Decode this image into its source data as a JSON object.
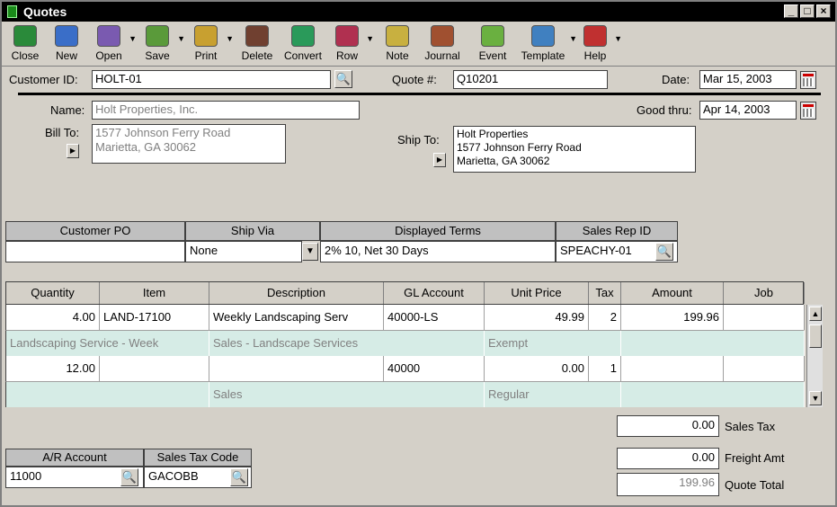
{
  "window": {
    "title": "Quotes"
  },
  "toolbar": [
    {
      "label": "Close",
      "icon": "close-icon"
    },
    {
      "label": "New",
      "icon": "new-icon"
    },
    {
      "label": "Open",
      "icon": "open-icon"
    },
    {
      "label": "Save",
      "icon": "save-icon"
    },
    {
      "label": "Print",
      "icon": "print-icon"
    },
    {
      "label": "Delete",
      "icon": "delete-icon"
    },
    {
      "label": "Convert",
      "icon": "convert-icon"
    },
    {
      "label": "Row",
      "icon": "row-icon"
    },
    {
      "label": "Note",
      "icon": "note-icon"
    },
    {
      "label": "Journal",
      "icon": "journal-icon"
    },
    {
      "label": "Event",
      "icon": "event-icon"
    },
    {
      "label": "Template",
      "icon": "template-icon"
    },
    {
      "label": "Help",
      "icon": "help-icon"
    }
  ],
  "header": {
    "customer_id_label": "Customer ID:",
    "customer_id": "HOLT-01",
    "quote_label": "Quote #:",
    "quote_no": "Q10201",
    "date_label": "Date:",
    "date": "Mar 15, 2003",
    "name_label": "Name:",
    "name": "Holt Properties, Inc.",
    "good_thru_label": "Good thru:",
    "good_thru": "Apr 14, 2003",
    "bill_to_label": "Bill To:",
    "bill_to_1": "1577 Johnson Ferry Road",
    "bill_to_2": "Marietta, GA 30062",
    "ship_to_label": "Ship To:",
    "ship_to_1": "Holt Properties",
    "ship_to_2": "1577 Johnson Ferry Road",
    "ship_to_3": "Marietta, GA 30062"
  },
  "terms": {
    "po_label": "Customer PO",
    "ship_via_label": "Ship Via",
    "terms_label": "Displayed Terms",
    "rep_label": "Sales Rep ID",
    "po": "",
    "ship_via": "None",
    "terms": "2% 10, Net 30 Days",
    "rep": "SPEACHY-01"
  },
  "grid": {
    "columns": [
      "Quantity",
      "Item",
      "Description",
      "GL Account",
      "Unit Price",
      "Tax",
      "Amount",
      "Job"
    ],
    "rows": [
      {
        "qty": "4.00",
        "item": "LAND-17100",
        "desc": "Weekly Landscaping Serv",
        "gl": "40000-LS",
        "price": "49.99",
        "tax": "2",
        "amount": "199.96",
        "job": "",
        "sub_item": "Landscaping Service - Week",
        "sub_desc": "Sales - Landscape Services",
        "sub_tax": "Exempt"
      },
      {
        "qty": "12.00",
        "item": "",
        "desc": "",
        "gl": "40000",
        "price": "0.00",
        "tax": "1",
        "amount": "",
        "job": "",
        "sub_item": "",
        "sub_desc": "Sales",
        "sub_tax": "Regular"
      }
    ]
  },
  "totals": {
    "sales_tax": "0.00",
    "sales_tax_label": "Sales Tax",
    "freight": "0.00",
    "freight_label": "Freight Amt",
    "total": "199.96",
    "total_label": "Quote Total"
  },
  "footer": {
    "ar_label": "A/R Account",
    "ar": "11000",
    "tax_code_label": "Sales Tax Code",
    "tax_code": "GACOBB"
  },
  "colors": {
    "mint_row": "#d6ece6",
    "title_bar": "#000000",
    "window": "#d4d0c8"
  }
}
